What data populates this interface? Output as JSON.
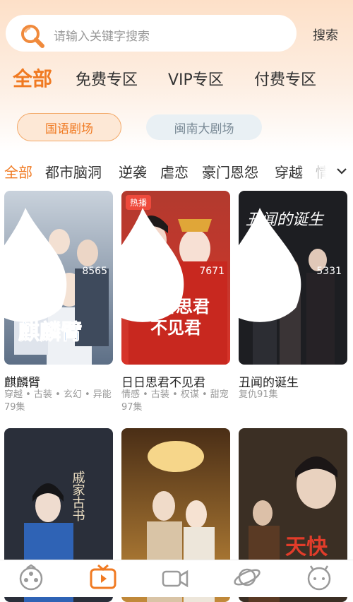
{
  "search": {
    "placeholder": "请输入关键字搜索",
    "button": "搜索"
  },
  "top_tabs": [
    {
      "label": "全部",
      "active": true
    },
    {
      "label": "免费专区",
      "active": false
    },
    {
      "label": "VIP专区",
      "active": false
    },
    {
      "label": "付费专区",
      "active": false
    }
  ],
  "theaters": [
    {
      "label": "国语剧场",
      "active": true
    },
    {
      "label": "闽南大剧场",
      "active": false
    }
  ],
  "categories": [
    "全部",
    "都市脑洞",
    "逆袭",
    "虐恋",
    "豪门恩怨",
    "穿越",
    "情感"
  ],
  "cards": [
    {
      "title": "麒麟臂",
      "tags": "穿越 • 古装 • 玄幻 • 异能79集",
      "views": "8565",
      "poster_text": "麒麟臂"
    },
    {
      "title": "日日思君不见君",
      "tags": "情感 • 古装 • 权谋 • 甜宠97集",
      "views": "7671",
      "badge": "热播",
      "poster_line1": "日日思君",
      "poster_line2": "不见君"
    },
    {
      "title": "丑闻的诞生",
      "tags": "复仇91集",
      "views": "5331",
      "poster_text": "丑闻的诞生"
    },
    {
      "title": "",
      "tags": "",
      "views": "",
      "poster_text": "戚家古书"
    },
    {
      "title": "",
      "tags": "",
      "views": ""
    },
    {
      "title": "",
      "tags": "",
      "views": "",
      "poster_text": "天快"
    }
  ],
  "tab_bar": [
    {
      "icon": "film-reel-icon",
      "active": false
    },
    {
      "icon": "tv-play-icon",
      "active": true
    },
    {
      "icon": "video-camera-icon",
      "active": false
    },
    {
      "icon": "planet-icon",
      "active": false
    },
    {
      "icon": "profile-face-icon",
      "active": false
    }
  ],
  "colors": {
    "accent": "#f07a22",
    "badge": "#ee4a3c",
    "muted": "#999999",
    "icon_gray": "#9a9a9a"
  }
}
